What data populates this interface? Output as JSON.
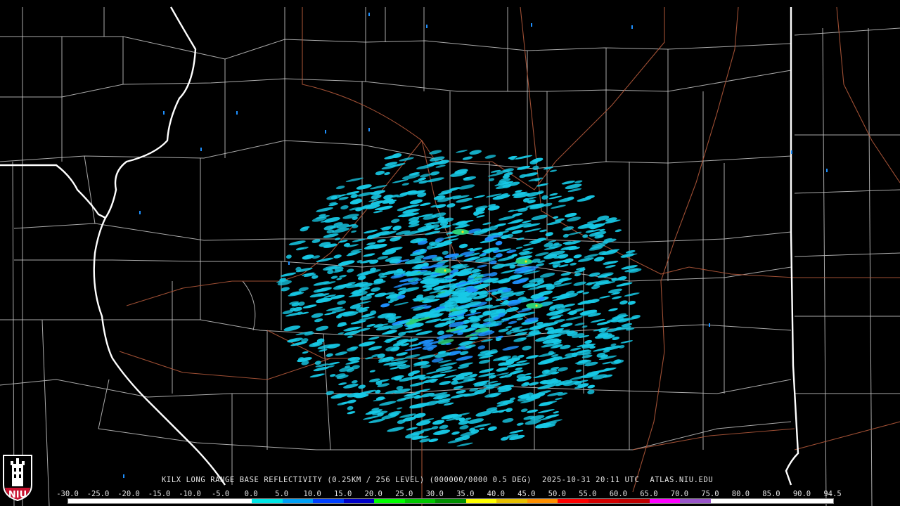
{
  "caption": {
    "product": "KILX LONG RANGE BASE REFLECTIVITY (0.25KM / 256 LEVEL) (000000/0000 0.5 DEG)",
    "timestamp": "2025-10-31 20:11 UTC",
    "site": "ATLAS.NIU.EDU"
  },
  "logo": {
    "text": "NIU",
    "colors": {
      "background": "#c8102e",
      "outline": "#ffffff"
    }
  },
  "legend": {
    "units_label": "",
    "ticks": [
      "-30.0",
      "-25.0",
      "-20.0",
      "-15.0",
      "-10.0",
      "-5.0",
      "0.0",
      "5.0",
      "10.0",
      "15.0",
      "20.0",
      "25.0",
      "30.0",
      "35.0",
      "40.0",
      "45.0",
      "50.0",
      "55.0",
      "60.0",
      "65.0",
      "70.0",
      "75.0",
      "80.0",
      "85.0",
      "90.0",
      "94.5"
    ],
    "colors": [
      "#ffffff",
      "#ffffff",
      "#ffffff",
      "#ffffff",
      "#ffffff",
      "#ffffff",
      "#00e6e6",
      "#00a0f5",
      "#0040ff",
      "#0000c8",
      "#00ff00",
      "#00c800",
      "#009000",
      "#ffff00",
      "#e7c000",
      "#ff9000",
      "#ff0000",
      "#d40000",
      "#c00000",
      "#ff00ff",
      "#9955c9",
      "#ffffff",
      "#ffffff",
      "#ffffff",
      "#ffffff"
    ]
  },
  "map": {
    "radar_site": "KILX",
    "colors": {
      "background": "#000000",
      "county_lines": "#c8c8c8",
      "state_lines": "#ffffff",
      "highways": "#b0583a",
      "echo_light": "#17c9e6",
      "echo_medium": "#1e90ff",
      "echo_strong": "#2bd17a",
      "echo_core": "#f5e21a"
    }
  }
}
